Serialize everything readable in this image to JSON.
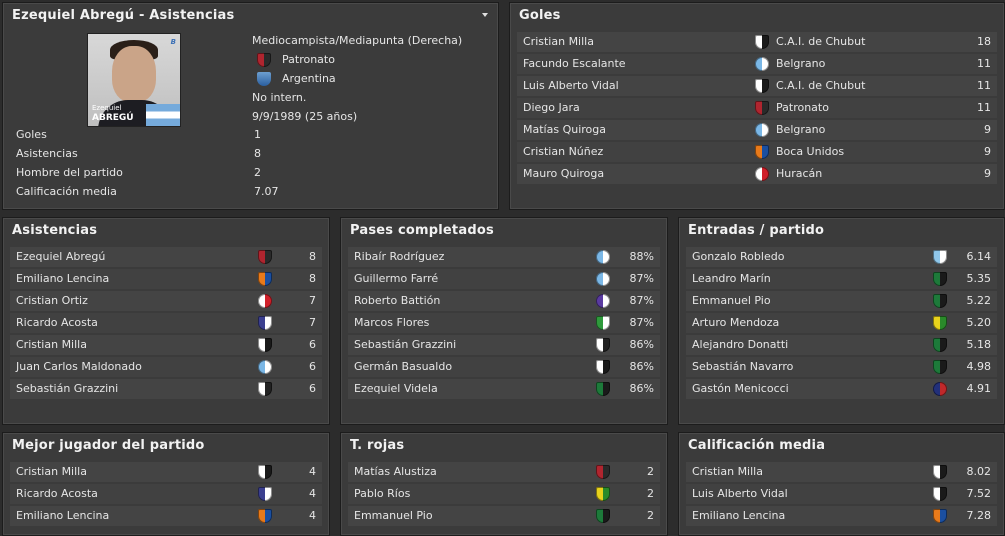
{
  "profile": {
    "title": "Ezequiel Abregú - Asistencias",
    "photo_caption_first": "Ezequiel",
    "photo_caption_last": "ABREGÚ",
    "position": "Mediocampista/Mediapunta (Derecha)",
    "club": "Patronato",
    "nationality": "Argentina",
    "international": "No intern.",
    "birth": "9/9/1989 (25 años)",
    "stats": [
      {
        "label": "Goles",
        "value": "1"
      },
      {
        "label": "Asistencias",
        "value": "8"
      },
      {
        "label": "Hombre del partido",
        "value": "2"
      },
      {
        "label": "Calificación media",
        "value": "7.07"
      }
    ]
  },
  "goles": {
    "title": "Goles",
    "rows": [
      {
        "name": "Cristian Milla",
        "club": "C.A.I. de Chubut",
        "crest": "cai",
        "value": "18"
      },
      {
        "name": "Facundo Escalante",
        "club": "Belgrano",
        "crest": "belgrano",
        "value": "11"
      },
      {
        "name": "Luis Alberto Vidal",
        "club": "C.A.I. de Chubut",
        "crest": "cai",
        "value": "11"
      },
      {
        "name": "Diego Jara",
        "club": "Patronato",
        "crest": "patronato",
        "value": "11"
      },
      {
        "name": "Matías Quiroga",
        "club": "Belgrano",
        "crest": "belgrano",
        "value": "9"
      },
      {
        "name": "Cristian Núñez",
        "club": "Boca Unidos",
        "crest": "boca-unidos",
        "value": "9"
      },
      {
        "name": "Mauro Quiroga",
        "club": "Huracán",
        "crest": "huracan",
        "value": "9"
      }
    ]
  },
  "asistencias": {
    "title": "Asistencias",
    "rows": [
      {
        "name": "Ezequiel Abregú",
        "crest": "patronato",
        "value": "8"
      },
      {
        "name": "Emiliano Lencina",
        "crest": "boca-unidos",
        "value": "8"
      },
      {
        "name": "Cristian Ortiz",
        "crest": "huracan",
        "value": "7"
      },
      {
        "name": "Ricardo Acosta",
        "crest": "stripes",
        "value": "7"
      },
      {
        "name": "Cristian Milla",
        "crest": "cai",
        "value": "6"
      },
      {
        "name": "Juan Carlos Maldonado",
        "crest": "belgrano",
        "value": "6"
      },
      {
        "name": "Sebastián Grazzini",
        "crest": "white-black",
        "value": "6"
      }
    ]
  },
  "pases": {
    "title": "Pases completados",
    "rows": [
      {
        "name": "Ribaír Rodríguez",
        "crest": "belgrano",
        "value": "88%"
      },
      {
        "name": "Guillermo Farré",
        "crest": "belgrano",
        "value": "87%"
      },
      {
        "name": "Roberto Battión",
        "crest": "purple",
        "value": "87%"
      },
      {
        "name": "Marcos Flores",
        "crest": "green-stripes",
        "value": "87%"
      },
      {
        "name": "Sebastián Grazzini",
        "crest": "white-black",
        "value": "86%"
      },
      {
        "name": "Germán Basualdo",
        "crest": "cai",
        "value": "86%"
      },
      {
        "name": "Ezequiel Videla",
        "crest": "green-black",
        "value": "86%"
      }
    ]
  },
  "entradas": {
    "title": "Entradas / partido",
    "rows": [
      {
        "name": "Gonzalo Robledo",
        "crest": "lightblue",
        "value": "6.14"
      },
      {
        "name": "Leandro Marín",
        "crest": "green-black",
        "value": "5.35"
      },
      {
        "name": "Emmanuel Pio",
        "crest": "green-black",
        "value": "5.22"
      },
      {
        "name": "Arturo Mendoza",
        "crest": "defensa",
        "value": "5.20"
      },
      {
        "name": "Alejandro Donatti",
        "crest": "green-black",
        "value": "5.18"
      },
      {
        "name": "Sebastián Navarro",
        "crest": "green-black",
        "value": "4.98"
      },
      {
        "name": "Gastón Menicocci",
        "crest": "blue-red",
        "value": "4.91"
      }
    ]
  },
  "mejor": {
    "title": "Mejor jugador del partido",
    "rows": [
      {
        "name": "Cristian Milla",
        "crest": "cai",
        "value": "4"
      },
      {
        "name": "Ricardo Acosta",
        "crest": "stripes",
        "value": "4"
      },
      {
        "name": "Emiliano Lencina",
        "crest": "boca-unidos",
        "value": "4"
      }
    ]
  },
  "rojas": {
    "title": "T. rojas",
    "rows": [
      {
        "name": "Matías Alustiza",
        "crest": "patronato",
        "value": "2"
      },
      {
        "name": "Pablo Ríos",
        "crest": "defensa",
        "value": "2"
      },
      {
        "name": "Emmanuel Pio",
        "crest": "green-black",
        "value": "2"
      }
    ]
  },
  "calificacion": {
    "title": "Calificación media",
    "rows": [
      {
        "name": "Cristian Milla",
        "crest": "cai",
        "value": "8.02"
      },
      {
        "name": "Luis Alberto Vidal",
        "crest": "cai",
        "value": "7.52"
      },
      {
        "name": "Emiliano Lencina",
        "crest": "boca-unidos",
        "value": "7.28"
      }
    ]
  },
  "crest_colors": {
    "patronato": [
      "#b0252f",
      "#2a2a2a"
    ],
    "belgrano": [
      "#7ab7e6",
      "#ffffff"
    ],
    "cai": [
      "#ffffff",
      "#1a1a1a"
    ],
    "boca-unidos": [
      "#e87a1a",
      "#1b4fa0"
    ],
    "huracan": [
      "#ffffff",
      "#d0202a"
    ],
    "stripes": [
      "#3b3f8f",
      "#ffffff"
    ],
    "white-black": [
      "#ffffff",
      "#222222"
    ],
    "purple": [
      "#5a3aa0",
      "#ffffff"
    ],
    "green-stripes": [
      "#2f9a3c",
      "#ffffff"
    ],
    "green-black": [
      "#1d7a3a",
      "#1a1a1a"
    ],
    "lightblue": [
      "#8fc7ea",
      "#ffffff"
    ],
    "defensa": [
      "#e8d21c",
      "#2a8a2a"
    ],
    "blue-red": [
      "#22307a",
      "#c0282a"
    ]
  }
}
